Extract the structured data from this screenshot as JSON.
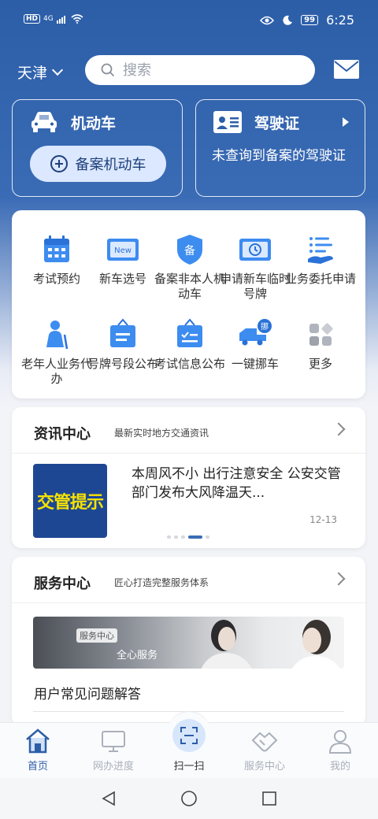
{
  "status_bar": {
    "network": "HD",
    "signal": "4G",
    "battery": "99",
    "time": "6:25"
  },
  "header": {
    "city": "天津",
    "search_placeholder": "搜索"
  },
  "vehicle_card": {
    "title": "机动车",
    "button": "备案机动车"
  },
  "license_card": {
    "title": "驾驶证",
    "message": "未查询到备案的驾驶证"
  },
  "services": [
    {
      "label": "考试预约",
      "icon": "calendar-icon"
    },
    {
      "label": "新车选号",
      "icon": "new-plate-icon"
    },
    {
      "label": "备案非本人机动车",
      "icon": "shield-badge-icon"
    },
    {
      "label": "申请新车临时号牌",
      "icon": "temp-plate-icon"
    },
    {
      "label": "业务委托申请",
      "icon": "hand-list-icon"
    },
    {
      "label": "老年人业务代办",
      "icon": "elderly-person-icon"
    },
    {
      "label": "号牌号段公布",
      "icon": "plate-board-icon"
    },
    {
      "label": "考试信息公布",
      "icon": "exam-board-icon"
    },
    {
      "label": "一键挪车",
      "icon": "tow-truck-icon"
    },
    {
      "label": "更多",
      "icon": "more-grid-icon"
    }
  ],
  "news": {
    "title": "资讯中心",
    "subtitle": "最新实时地方交通资讯",
    "thumb_text": "交管提示",
    "headline": "本周风不小 出行注意安全 公安交管部门发布大风降温天...",
    "date": "12-13"
  },
  "service_center": {
    "title": "服务中心",
    "subtitle": "匠心打造完整服务体系",
    "banner_label": "服务中心",
    "banner_sub": "全心服务",
    "faq": "用户常见问题解答"
  },
  "bottom_nav": {
    "home": "首页",
    "progress": "网办进度",
    "scan": "扫一扫",
    "service": "服务中心",
    "mine": "我的"
  },
  "colors": {
    "primary": "#2c5ea8",
    "accent_icon": "#3d8cf0",
    "thumb_bg": "#1e4793",
    "thumb_text": "#f6e200"
  }
}
